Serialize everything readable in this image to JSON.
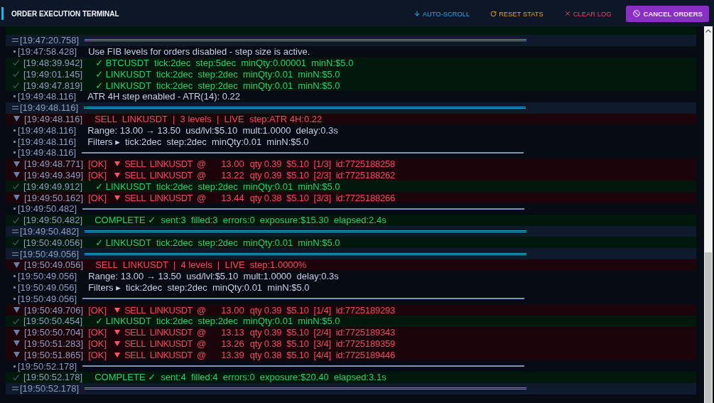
{
  "header": {
    "title": "ORDER EXECUTION TERMINAL",
    "actions": [
      {
        "kind": "auto_scroll",
        "label": "AUTO-SCROLL"
      },
      {
        "kind": "reset",
        "label": "RESET STATS"
      },
      {
        "kind": "clear",
        "label": "CLEAR LOG"
      }
    ],
    "cancel_button": {
      "label": "CANCEL ORDERS"
    }
  },
  "log": [
    {
      "kind": "success",
      "clipped": true
    },
    {
      "kind": "separator",
      "time": "[19:47:20.758]"
    },
    {
      "kind": "info",
      "time": "[19:47:58.428]",
      "text": "Use FIB levels for orders disabled - step size is active."
    },
    {
      "kind": "success",
      "time": "[19:48:39.942]",
      "text": "✓ BTCUSDT  tick:2dec  step:5dec  minQty:0.00001  minN:$5.0"
    },
    {
      "kind": "success",
      "time": "[19:49:01.145]",
      "text": "✓ LINKUSDT  tick:2dec  step:2dec  minQty:0.01  minN:$5.0"
    },
    {
      "kind": "success",
      "time": "[19:49:47.819]",
      "text": "✓ LINKUSDT  tick:2dec  step:2dec  minQty:0.01  minN:$5.0"
    },
    {
      "kind": "info",
      "time": "[19:49:48.116]",
      "text": "ATR 4H step enabled - ATR(14): 0.22"
    },
    {
      "kind": "separator",
      "time": "[19:49:48.116]"
    },
    {
      "kind": "sell_header",
      "time": "[19:49:48.116]",
      "text": "SELL  LINKUSDT  |  3 levels  |  LIVE  step:ATR 4H:0.22"
    },
    {
      "kind": "info",
      "time": "[19:49:48.116]",
      "text": "Range: 13.00 → 13.50  usd/lvl:$5.10  mult:1.0000  delay:0.3s"
    },
    {
      "kind": "info",
      "time": "[19:49:48.116]",
      "text": "Filters ▸  tick:2dec  step:2dec  minQty:0.01  minN:$5.0"
    },
    {
      "kind": "divider",
      "time": "[19:49:48.116]"
    },
    {
      "kind": "order",
      "time": "[19:49:48.771]",
      "status": "[OK]",
      "order": "SELL  LINKUSDT  @",
      "price": "13.00",
      "details": "qty 0.39  $5.10  [1/3]  id:7725188258"
    },
    {
      "kind": "order",
      "time": "[19:49:49.349]",
      "status": "[OK]",
      "order": "SELL  LINKUSDT  @",
      "price": "13.22",
      "details": "qty 0.39  $5.10  [2/3]  id:7725188262"
    },
    {
      "kind": "success",
      "time": "[19:49:49.912]",
      "text": "✓ LINKUSDT  tick:2dec  step:2dec  minQty:0.01  minN:$5.0"
    },
    {
      "kind": "order",
      "time": "[19:49:50.162]",
      "status": "[OK]",
      "order": "SELL  LINKUSDT  @",
      "price": "13.44",
      "details": "qty 0.38  $5.10  [3/3]  id:7725188266"
    },
    {
      "kind": "divider",
      "time": "[19:49:50.482]"
    },
    {
      "kind": "complete",
      "time": "[19:49:50.482]",
      "text": "COMPLETE ✓  sent:3  filled:3  errors:0  exposure:$15.30  elapsed:2.4s"
    },
    {
      "kind": "separator",
      "time": "[19:49:50.482]"
    },
    {
      "kind": "success",
      "time": "[19:50:49.056]",
      "text": "✓ LINKUSDT  tick:2dec  step:2dec  minQty:0.01  minN:$5.0"
    },
    {
      "kind": "separator",
      "time": "[19:50:49.056]"
    },
    {
      "kind": "sell_header",
      "time": "[19:50:49.056]",
      "text": "SELL  LINKUSDT  |  4 levels  |  LIVE  step:1.0000%"
    },
    {
      "kind": "info",
      "time": "[19:50:49.056]",
      "text": "Range: 13.00 → 13.50  usd/lvl:$5.10  mult:1.0000  delay:0.3s"
    },
    {
      "kind": "info",
      "time": "[19:50:49.056]",
      "text": "Filters ▸  tick:2dec  step:2dec  minQty:0.01  minN:$5.0"
    },
    {
      "kind": "divider",
      "time": "[19:50:49.056]"
    },
    {
      "kind": "order",
      "time": "[19:50:49.706]",
      "status": "[OK]",
      "order": "SELL  LINKUSDT  @",
      "price": "13.00",
      "details": "qty 0.39  $5.10  [1/4]  id:7725189293"
    },
    {
      "kind": "success",
      "time": "[19:50:50.454]",
      "text": "✓ LINKUSDT  tick:2dec  step:2dec  minQty:0.01  minN:$5.0"
    },
    {
      "kind": "order",
      "time": "[19:50:50.704]",
      "status": "[OK]",
      "order": "SELL  LINKUSDT  @",
      "price": "13.13",
      "details": "qty 0.39  $5.10  [2/4]  id:7725189343"
    },
    {
      "kind": "order",
      "time": "[19:50:51.283]",
      "status": "[OK]",
      "order": "SELL  LINKUSDT  @",
      "price": "13.26",
      "details": "qty 0.38  $5.10  [3/4]  id:7725189359"
    },
    {
      "kind": "order",
      "time": "[19:50:51.865]",
      "status": "[OK]",
      "order": "SELL  LINKUSDT  @",
      "price": "13.39",
      "details": "qty 0.38  $5.10  [4/4]  id:7725189446"
    },
    {
      "kind": "divider",
      "time": "[19:50:52.178]"
    },
    {
      "kind": "complete",
      "time": "[19:50:52.178]",
      "text": "COMPLETE ✓  sent:4  filled:4  errors:0  exposure:$20.40  elapsed:3.1s"
    },
    {
      "kind": "separator",
      "time": "[19:50:52.178]"
    }
  ]
}
